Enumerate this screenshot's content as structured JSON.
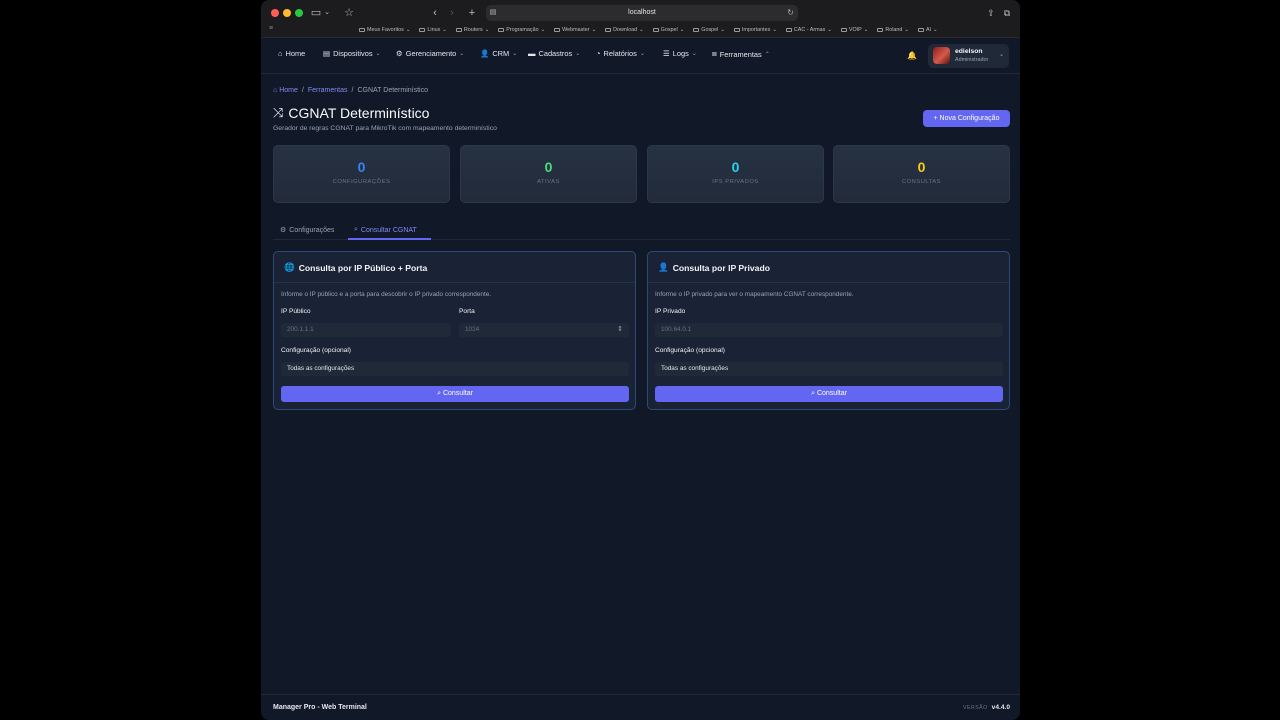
{
  "browser": {
    "url": "localhost",
    "bookmarks": [
      "Meus Favoritos",
      "Linux",
      "Routers",
      "Programação",
      "Webmaster",
      "Download",
      "Gospel",
      "Gospel",
      "Importantes",
      "CAC - Armas",
      "VOIP",
      "Roland",
      "AI"
    ]
  },
  "nav": {
    "items": [
      {
        "label": "Home",
        "icon": "home-icon"
      },
      {
        "label": "Dispositivos",
        "icon": "server-icon"
      },
      {
        "label": "Gerenciamento",
        "icon": "cogs-icon"
      },
      {
        "label": "CRM",
        "icon": "user-icon"
      },
      {
        "label": "Cadastros",
        "icon": "folder-icon"
      },
      {
        "label": "Relatórios",
        "icon": "chart-pie-icon"
      },
      {
        "label": "Logs",
        "icon": "list-icon"
      },
      {
        "label": "Ferramentas",
        "icon": "toolbox-icon"
      }
    ],
    "user": {
      "name": "edielson",
      "role": "Administrador"
    }
  },
  "breadcrumb": {
    "home": "Home",
    "parent": "Ferramentas",
    "current": "CGNAT Determinístico"
  },
  "page": {
    "title": "CGNAT Determinístico",
    "subtitle": "Gerador de regras CGNAT para MikroTik com mapeamento determinístico",
    "new_button": "Nova Configuração"
  },
  "stats": [
    {
      "value": "0",
      "label": "CONFIGURAÇÕES",
      "color": "#3b82f6"
    },
    {
      "value": "0",
      "label": "ATIVAS",
      "color": "#4ade80"
    },
    {
      "value": "0",
      "label": "IPS PRIVADOS",
      "color": "#22d3ee"
    },
    {
      "value": "0",
      "label": "CONSULTAS",
      "color": "#facc15"
    }
  ],
  "tabs": {
    "configs": "Configurações",
    "consult": "Consultar CGNAT"
  },
  "panel_public": {
    "title": "Consulta por IP Público + Porta",
    "desc": "Informe o IP público e a porta para descobrir o IP privado correspondente.",
    "ip_label": "IP Público",
    "ip_placeholder": "200.1.1.1",
    "port_label": "Porta",
    "port_placeholder": "1024",
    "config_label": "Configuração (opcional)",
    "config_value": "Todas as configurações",
    "button": "Consultar"
  },
  "panel_private": {
    "title": "Consulta por IP Privado",
    "desc": "Informe o IP privado para ver o mapeamento CGNAT correspondente.",
    "ip_label": "IP Privado",
    "ip_placeholder": "100.64.0.1",
    "config_label": "Configuração (opcional)",
    "config_value": "Todas as configurações",
    "button": "Consultar"
  },
  "footer": {
    "left": "Manager Pro - Web Terminal",
    "version_label": "VERSÃO",
    "version": "v4.4.0"
  }
}
